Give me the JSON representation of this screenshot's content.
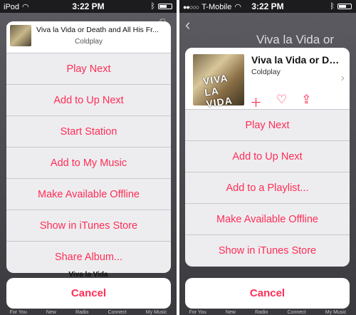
{
  "colors": {
    "accent": "#ff2d55",
    "sheet_bg": "#ededf0",
    "dim_bg": "#3a3a3e"
  },
  "left": {
    "status": {
      "carrier": "iPod",
      "time": "3:22 PM"
    },
    "header": {
      "title": "Viva la Vida or Death and All His Fr...",
      "artist": "Coldplay"
    },
    "menu": [
      "Play Next",
      "Add to Up Next",
      "Start Station",
      "Add to My Music",
      "Make Available Offline",
      "Show in iTunes Store",
      "Share Album..."
    ],
    "mini_player_title": "Viva la Vida",
    "cancel": "Cancel",
    "tabs": [
      "For You",
      "New",
      "Radio",
      "Connect",
      "My Music"
    ]
  },
  "right": {
    "status": {
      "carrier": "T-Mobile",
      "time": "3:22 PM"
    },
    "background_title": "Viva la Vida or",
    "header": {
      "title": "Viva la Vida or De...",
      "artist": "Coldplay",
      "art_text": "VIVA LA VIDA"
    },
    "actions": [
      "plus-icon",
      "heart-icon",
      "share-icon"
    ],
    "menu": [
      "Play Next",
      "Add to Up Next",
      "Add to a Playlist...",
      "Make Available Offline",
      "Show in iTunes Store"
    ],
    "cancel": "Cancel",
    "tabs": [
      "For You",
      "New",
      "Radio",
      "Connect",
      "My Music"
    ]
  }
}
